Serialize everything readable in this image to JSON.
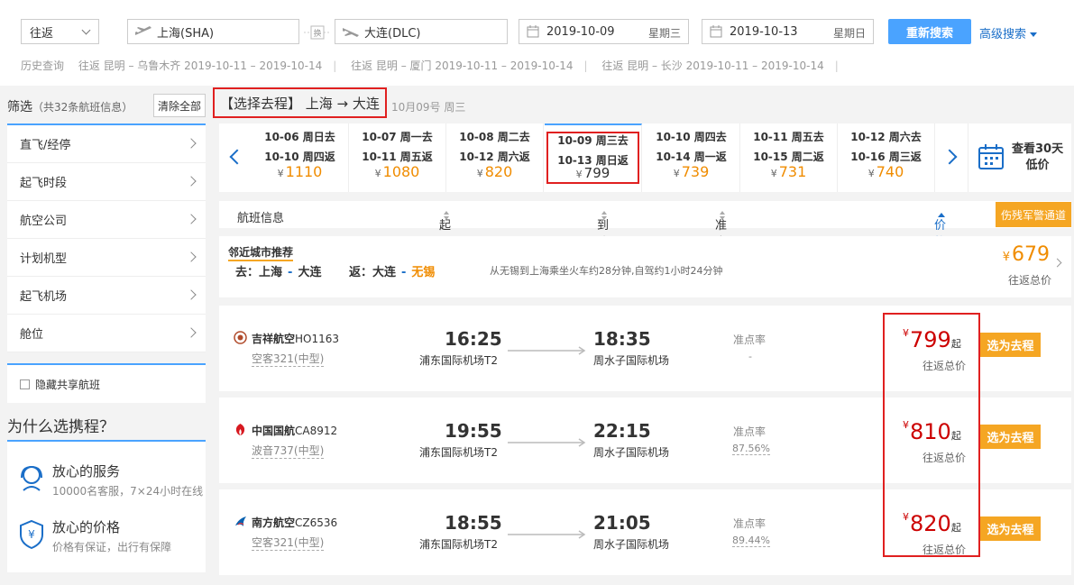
{
  "search": {
    "trip_type": "往返",
    "from_city": "上海(SHA)",
    "to_city": "大连(DLC)",
    "swap_label": "换",
    "depart_date": "2019-10-09",
    "depart_weekday": "星期三",
    "return_date": "2019-10-13",
    "return_weekday": "星期日",
    "search_button": "重新搜索",
    "advanced_link": "高级搜索"
  },
  "history": {
    "label": "历史查询",
    "items": [
      "往返 昆明 – 乌鲁木齐 2019-10-11 – 2019-10-14",
      "往返 昆明 – 厦门 2019-10-11 – 2019-10-14",
      "往返 昆明 – 长沙 2019-10-11 – 2019-10-14"
    ]
  },
  "filter": {
    "title": "筛选",
    "count_text": "（共32条航班信息）",
    "clear_all": "清除全部",
    "items": [
      "直飞/经停",
      "起飞时段",
      "航空公司",
      "计划机型",
      "起飞机场",
      "舱位"
    ],
    "hide_shared": "隐藏共享航班"
  },
  "why": {
    "title": "为什么选携程？",
    "items": [
      {
        "title": "放心的服务",
        "desc": "10000名客服，7×24小时在线"
      },
      {
        "title": "放心的价格",
        "desc": "价格有保证，出行有保障"
      }
    ]
  },
  "route": {
    "title": "【选择去程】 上海 → 大连",
    "date": "10月09号 周三"
  },
  "date_strip": {
    "currency": "¥",
    "cells": [
      {
        "go": "10-06 周日去",
        "back": "10-10 周四返",
        "price": "1110"
      },
      {
        "go": "10-07 周一去",
        "back": "10-11 周五返",
        "price": "1080"
      },
      {
        "go": "10-08 周二去",
        "back": "10-12 周六返",
        "price": "820"
      },
      {
        "go": "10-09 周三去",
        "back": "10-13 周日返",
        "price": "799"
      },
      {
        "go": "10-10 周四去",
        "back": "10-14 周一返",
        "price": "739"
      },
      {
        "go": "10-11 周五去",
        "back": "10-15 周二返",
        "price": "731"
      },
      {
        "go": "10-12 周六去",
        "back": "10-16 周三返",
        "price": "740"
      }
    ],
    "view30_line1": "查看30天",
    "view30_line2": "低价"
  },
  "columns": {
    "flight_info": "航班信息",
    "depart_time": "起飞时间",
    "arrive_time": "到达时间",
    "on_time": "准点率",
    "price": "价格",
    "military_button": "伤残军警通道"
  },
  "nearby": {
    "label": "邻近城市推荐",
    "go_label": "去：",
    "go_from": "上海",
    "go_to": "大连",
    "back_label": "返：",
    "back_from": "大连",
    "back_to": "无锡",
    "dash": "-",
    "note": "从无锡到上海乘坐火车约28分钟,自驾约1小时24分钟",
    "currency": "¥",
    "price": "679",
    "price_label": "往返总价"
  },
  "flights": [
    {
      "airline": "吉祥航空",
      "code": "HO1163",
      "aircraft": "空客321(中型)",
      "depart": "16:25",
      "depart_airport": "浦东国际机场T2",
      "arrive": "18:35",
      "arrive_airport": "周水子国际机场",
      "on_time_label": "准点率",
      "on_time": "-",
      "currency": "¥",
      "price": "799",
      "qi": "起",
      "price_label": "往返总价",
      "select": "选为去程",
      "logo_color": "#c8102e"
    },
    {
      "airline": "中国国航",
      "code": "CA8912",
      "aircraft": "波音737(中型)",
      "depart": "19:55",
      "depart_airport": "浦东国际机场T2",
      "arrive": "22:15",
      "arrive_airport": "周水子国际机场",
      "on_time_label": "准点率",
      "on_time": "87.56%",
      "currency": "¥",
      "price": "810",
      "qi": "起",
      "price_label": "往返总价",
      "select": "选为去程",
      "logo_color": "#d71920"
    },
    {
      "airline": "南方航空",
      "code": "CZ6536",
      "aircraft": "空客321(中型)",
      "depart": "18:55",
      "depart_airport": "浦东国际机场T2",
      "arrive": "21:05",
      "arrive_airport": "周水子国际机场",
      "on_time_label": "准点率",
      "on_time": "89.44%",
      "currency": "¥",
      "price": "820",
      "qi": "起",
      "price_label": "往返总价",
      "select": "选为去程",
      "logo_color": "#0a62b0"
    }
  ],
  "colors": {
    "accent_blue": "#4aa3ff",
    "link_blue": "#1a6ec8",
    "orange": "#f5a623",
    "price_red": "#c00",
    "highlight_red": "#e02020"
  }
}
